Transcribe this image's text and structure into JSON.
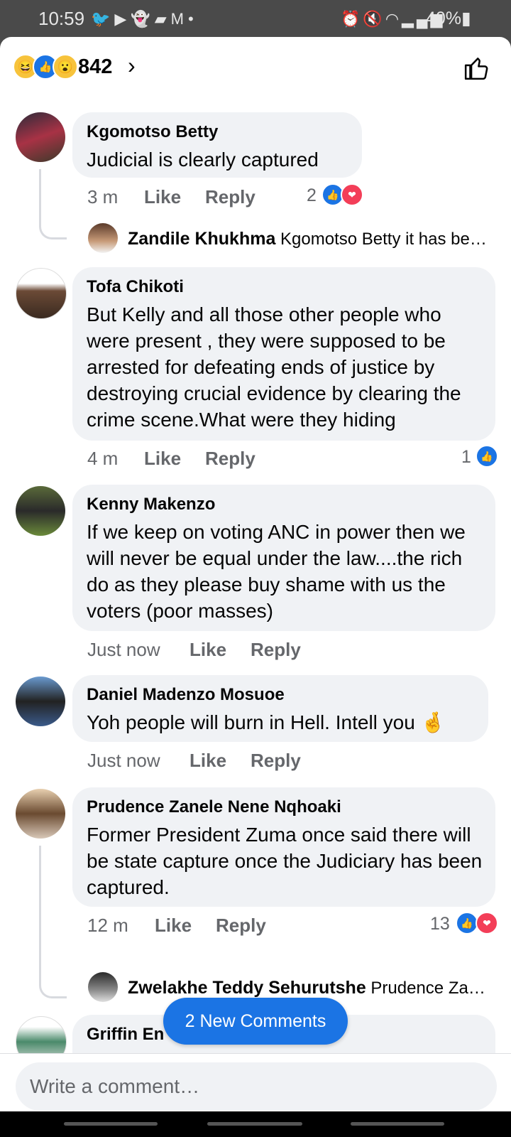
{
  "status_bar": {
    "time": "10:59",
    "battery": "40%",
    "left_icons": [
      "twitter-icon",
      "youtube-icon",
      "snapchat-icon",
      "message-icon",
      "gmail-icon",
      "dot-icon"
    ],
    "right_icons": [
      "alarm-icon",
      "mute-icon",
      "wifi-icon",
      "signal-icon",
      "battery-icon"
    ]
  },
  "header": {
    "reaction_icons": [
      "haha",
      "like",
      "wow"
    ],
    "reaction_count": "842",
    "chevron": "›"
  },
  "comments": [
    {
      "author": "Kgomotso Betty",
      "text": "Judicial is clearly captured",
      "time": "3 m",
      "like_label": "Like",
      "reply_label": "Reply",
      "reaction_count": "2",
      "reactions": [
        "like",
        "love"
      ],
      "reply_preview": {
        "author": "Zandile Khukhma",
        "text": "Kgomotso Betty it has be…"
      }
    },
    {
      "author": "Tofa Chikoti",
      "text": "But Kelly and all those other people who were present , they were supposed to be arrested for defeating ends of justice by destroying crucial evidence by clearing the crime scene.What were they hiding",
      "time": "4 m",
      "like_label": "Like",
      "reply_label": "Reply",
      "reaction_count": "1",
      "reactions": [
        "like"
      ]
    },
    {
      "author": "Kenny Makenzo",
      "text": "If we keep on voting ANC in power then we will never be equal under the law....the rich do as they please buy shame with us the voters (poor masses)",
      "time": "Just now",
      "like_label": "Like",
      "reply_label": "Reply"
    },
    {
      "author": "Daniel Madenzo Mosuoe",
      "text": "Yoh people will burn in Hell. Intell you 🤞",
      "time": "Just now",
      "like_label": "Like",
      "reply_label": "Reply"
    },
    {
      "author": "Prudence Zanele Nene Nqhoaki",
      "text": "Former President Zuma once said there will be state capture once the Judiciary has been captured.",
      "time": "12 m",
      "like_label": "Like",
      "reply_label": "Reply",
      "reaction_count": "13",
      "reactions": [
        "like",
        "love"
      ],
      "reply_preview": {
        "author": "Zwelakhe Teddy Sehurutshe",
        "text": "Prudence Za…"
      }
    },
    {
      "author": "Griffin En"
    }
  ],
  "new_comments_button": "2 New Comments",
  "composer": {
    "placeholder": "Write a comment…"
  },
  "colors": {
    "accent": "#1b74e4",
    "bubble": "#f0f2f5",
    "secondary_text": "#65676b",
    "love": "#f33e58"
  }
}
